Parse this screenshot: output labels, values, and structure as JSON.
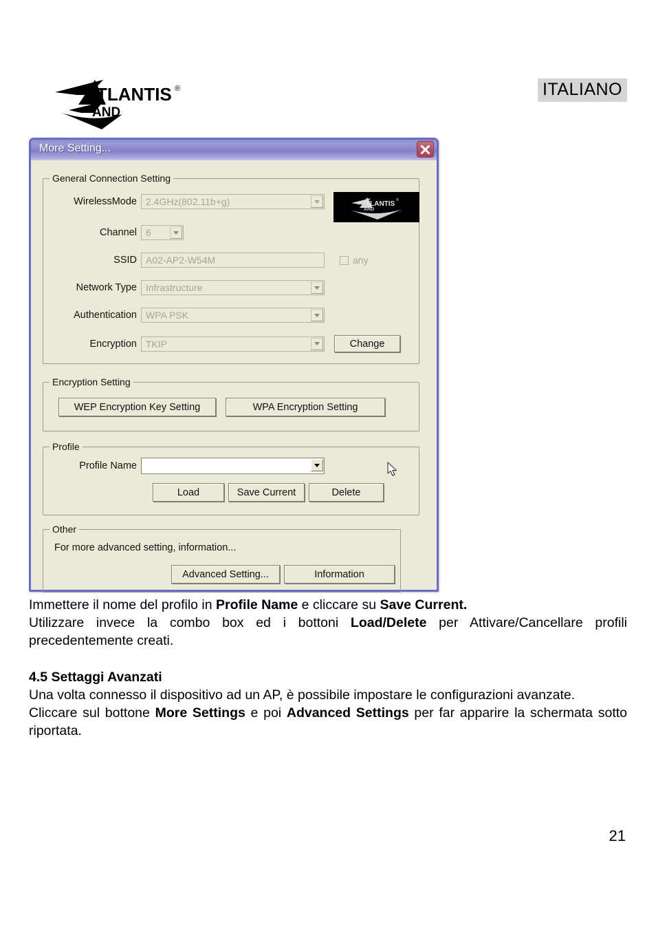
{
  "header": {
    "language_badge": "ITALIANO",
    "brand": "ATLANTIS LAND"
  },
  "dialog": {
    "title": "More Setting...",
    "close_icon": "close-icon",
    "groups": {
      "general": {
        "title": "General Connection Setting",
        "fields": [
          {
            "label": "WirelessMode",
            "value": "2.4GHz(802.11b+g)",
            "control": "combobox",
            "disabled": true
          },
          {
            "label": "Channel",
            "value": "6",
            "control": "combobox",
            "disabled": true
          },
          {
            "label": "SSID",
            "value": "A02-AP2-W54M",
            "control": "textbox",
            "disabled": true
          },
          {
            "label": "Network Type",
            "value": "Infrastructure",
            "control": "combobox",
            "disabled": true
          },
          {
            "label": "Authentication",
            "value": "WPA PSK",
            "control": "combobox",
            "disabled": true
          },
          {
            "label": "Encryption",
            "value": "TKIP",
            "control": "combobox",
            "disabled": true
          }
        ],
        "any_checkbox": {
          "label": "any",
          "checked": false,
          "disabled": true
        },
        "change_button": "Change"
      },
      "encryption": {
        "title": "Encryption Setting",
        "wep_button": "WEP Encryption Key Setting",
        "wpa_button": "WPA Encryption Setting"
      },
      "profile": {
        "title": "Profile",
        "profile_name_label": "Profile Name",
        "profile_name_value": "",
        "load_button": "Load",
        "save_current_button": "Save Current",
        "delete_button": "Delete"
      },
      "other": {
        "title": "Other",
        "description": "For more advanced setting, information...",
        "advanced_setting_button": "Advanced Setting...",
        "information_button": "Information"
      }
    }
  },
  "body": {
    "para1_a": "Immettere il nome del profilo in ",
    "para1_b": "Profile Name",
    "para1_c": " e cliccare su ",
    "para1_d": "Save Current.",
    "para2_a": "Utilizzare invece la combo box ed i bottoni ",
    "para2_b": "Load/Delete",
    "para2_c": " per Attivare/Cancellare profili precedentemente creati.",
    "section_heading": "4.5 Settaggi Avanzati",
    "para3": "Una volta connesso il dispositivo ad un AP, è possibile impostare le configurazioni avanzate.",
    "para4_a": "Cliccare sul bottone ",
    "para4_b": "More Settings",
    "para4_c": " e poi ",
    "para4_d": "Advanced Settings",
    "para4_e": " per far apparire la schermata sotto riportata."
  },
  "footer": {
    "page_number": "21"
  },
  "colors": {
    "dialog_face": "#ece9d8",
    "titlebar": "#8281c6",
    "dialog_border": "#6b6bc4",
    "close_button": "#b2566a",
    "badge_bg": "#d4d4d4"
  }
}
